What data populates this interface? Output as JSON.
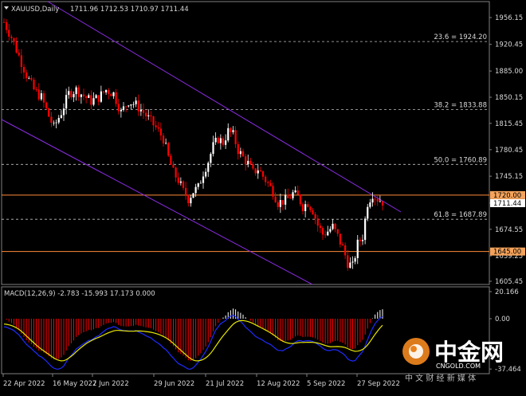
{
  "header": {
    "symbol": "XAUUSD,Daily",
    "ohlc": "1711.96 1712.53 1710.97 1711.44"
  },
  "colors": {
    "background": "#000000",
    "bull": "#ffffff",
    "bear": "#ff0000",
    "channel": "#8a2be2",
    "fib": "#c0c0c0",
    "hline": "#ff8c3a",
    "macd_line": "#1e2bff",
    "signal_line": "#e8e800",
    "label_bg": "#f5a35a"
  },
  "price_axis": [
    "1956.15",
    "1920.45",
    "1885.00",
    "1850.15",
    "1815.45",
    "1780.45",
    "1745.15",
    "1709.40",
    "1674.55",
    "1639.25",
    "1605.45"
  ],
  "fib_levels": [
    {
      "label": "23.6 = 1924.20",
      "price": 1924.2
    },
    {
      "label": "38.2 = 1833.88",
      "price": 1833.88
    },
    {
      "label": "50.0 = 1760.89",
      "price": 1760.89
    },
    {
      "label": "61.8 = 1687.89",
      "price": 1687.89
    }
  ],
  "h_lines": [
    {
      "label": "1720.00",
      "price": 1720.0
    },
    {
      "label": "1645.00",
      "price": 1645.0
    }
  ],
  "current_price": "1711.44",
  "macd": {
    "label": "MACD(12,26,9) -2.783 -15.993 17.173 0.000",
    "axis": [
      "20.166",
      "0.00",
      "-37.464"
    ]
  },
  "date_axis": [
    "22 Apr 2022",
    "16 May 2022",
    "7 Jun 2022",
    "29 Jun 2022",
    "21 Jul 2022",
    "12 Aug 2022",
    "5 Sep 2022",
    "27 Sep 2022"
  ],
  "logo": {
    "title": "中金网",
    "url": "CNGOLD.COM",
    "slogan": "中 文 财 经 新 媒 体"
  },
  "chart_data": {
    "type": "candlestick",
    "symbol": "XAUUSD",
    "timeframe": "Daily",
    "ylim": [
      1605.45,
      1956.15
    ],
    "x_tick_labels": [
      "22 Apr 2022",
      "16 May 2022",
      "7 Jun 2022",
      "29 Jun 2022",
      "21 Jul 2022",
      "12 Aug 2022",
      "5 Sep 2022",
      "27 Sep 2022"
    ],
    "close_path": [
      [
        0,
        1950
      ],
      [
        3,
        1930
      ],
      [
        6,
        1905
      ],
      [
        9,
        1880
      ],
      [
        12,
        1860
      ],
      [
        15,
        1850
      ],
      [
        18,
        1825
      ],
      [
        20,
        1810
      ],
      [
        23,
        1830
      ],
      [
        26,
        1855
      ],
      [
        29,
        1860
      ],
      [
        32,
        1852
      ],
      [
        35,
        1845
      ],
      [
        38,
        1850
      ],
      [
        41,
        1860
      ],
      [
        44,
        1855
      ],
      [
        47,
        1830
      ],
      [
        50,
        1845
      ],
      [
        53,
        1840
      ],
      [
        56,
        1830
      ],
      [
        59,
        1818
      ],
      [
        62,
        1805
      ],
      [
        64,
        1795
      ],
      [
        66,
        1770
      ],
      [
        68,
        1750
      ],
      [
        70,
        1740
      ],
      [
        72,
        1725
      ],
      [
        74,
        1715
      ],
      [
        76,
        1725
      ],
      [
        78,
        1730
      ],
      [
        80,
        1750
      ],
      [
        82,
        1765
      ],
      [
        84,
        1785
      ],
      [
        86,
        1795
      ],
      [
        88,
        1790
      ],
      [
        90,
        1805
      ],
      [
        92,
        1800
      ],
      [
        94,
        1780
      ],
      [
        96,
        1770
      ],
      [
        98,
        1762
      ],
      [
        100,
        1750
      ],
      [
        102,
        1755
      ],
      [
        104,
        1745
      ],
      [
        106,
        1735
      ],
      [
        108,
        1725
      ],
      [
        110,
        1710
      ],
      [
        112,
        1712
      ],
      [
        114,
        1715
      ],
      [
        116,
        1722
      ],
      [
        118,
        1718
      ],
      [
        120,
        1705
      ],
      [
        122,
        1710
      ],
      [
        124,
        1700
      ],
      [
        126,
        1680
      ],
      [
        128,
        1668
      ],
      [
        130,
        1672
      ],
      [
        132,
        1678
      ],
      [
        134,
        1665
      ],
      [
        136,
        1650
      ],
      [
        138,
        1630
      ],
      [
        140,
        1625
      ],
      [
        142,
        1655
      ],
      [
        144,
        1665
      ],
      [
        146,
        1710
      ],
      [
        148,
        1722
      ],
      [
        150,
        1715
      ],
      [
        152,
        1711.44
      ]
    ],
    "macd_histogram_range": [
      -37.464,
      20.166
    ]
  }
}
